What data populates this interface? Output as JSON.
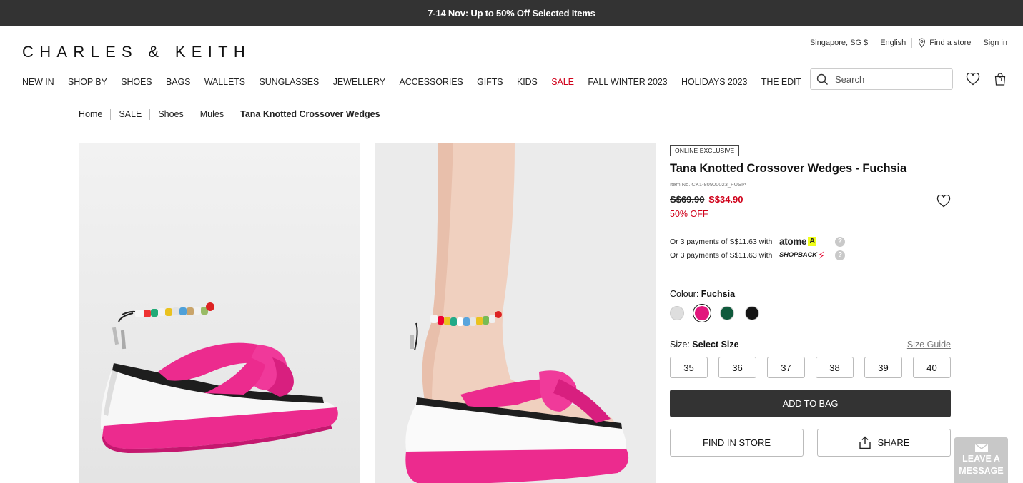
{
  "promo": {
    "text": "7-14 Nov: Up to 50% Off Selected Items"
  },
  "header": {
    "logo": "CHARLES & KEITH",
    "utility": {
      "region": "Singapore, SG $",
      "language": "English",
      "find_store": "Find a store",
      "sign_in": "Sign in"
    },
    "nav": [
      "NEW IN",
      "SHOP BY",
      "SHOES",
      "BAGS",
      "WALLETS",
      "SUNGLASSES",
      "JEWELLERY",
      "ACCESSORIES",
      "GIFTS",
      "KIDS",
      "SALE",
      "FALL WINTER 2023",
      "HOLIDAYS 2023",
      "THE EDIT"
    ],
    "search_placeholder": "Search",
    "cart_count": "0"
  },
  "breadcrumb": [
    "Home",
    "SALE",
    "Shoes",
    "Mules",
    "Tana Knotted Crossover Wedges"
  ],
  "product": {
    "badge": "ONLINE EXCLUSIVE",
    "title": "Tana Knotted Crossover Wedges - Fuchsia",
    "item_no": "Item No. CK1-80900023_FUSIA",
    "original_price": "S$69.90",
    "sale_price": "S$34.90",
    "discount": "50% OFF",
    "payments": [
      {
        "text": "Or 3 payments of S$11.63 with",
        "provider": "atome",
        "mark": "A"
      },
      {
        "text": "Or 3 payments of S$11.63 with",
        "provider": "SHOPBACK",
        "mark": "⚡"
      }
    ],
    "colour_label": "Colour:",
    "colour_value": "Fuchsia",
    "colours": [
      "#dedede",
      "#e2177d",
      "#0f5a3c",
      "#151515"
    ],
    "selected_colour": 1,
    "size_label": "Size:",
    "size_value": "Select Size",
    "size_guide": "Size Guide",
    "sizes": [
      "35",
      "36",
      "37",
      "38",
      "39",
      "40"
    ],
    "add_to_bag": "ADD TO BAG",
    "find_in_store": "FIND IN STORE",
    "share": "SHARE"
  },
  "chat_widget": {
    "line1": "LEAVE A",
    "line2": "MESSAGE"
  },
  "colors": {
    "accent": "#d0021b",
    "dark": "#333333",
    "fuchsia": "#ec2b8e"
  }
}
